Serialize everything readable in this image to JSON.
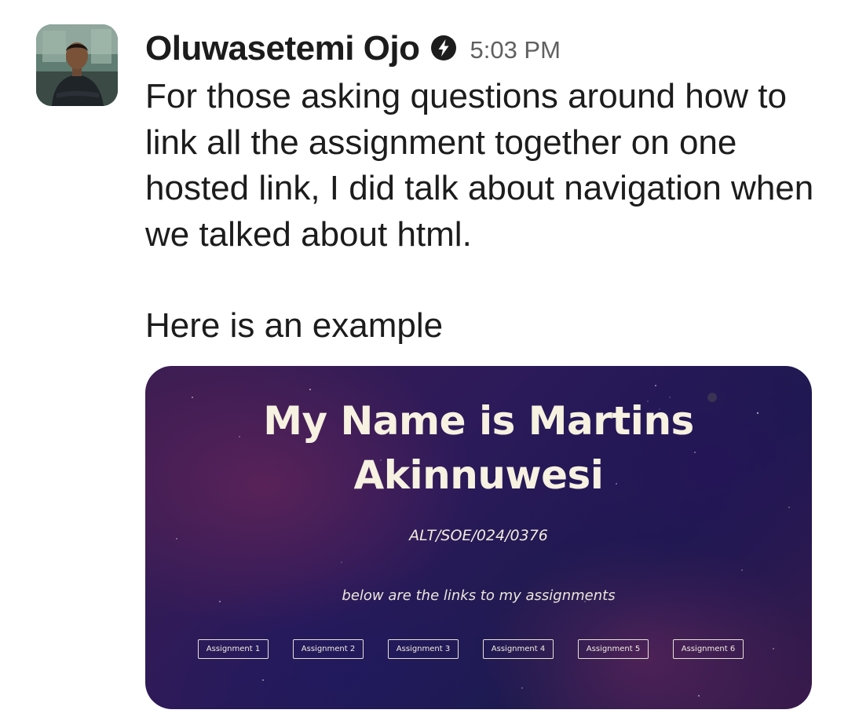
{
  "message": {
    "sender_name": "Oluwasetemi Ojo",
    "status_icon": "lightning-bolt-icon",
    "timestamp": "5:03 PM",
    "paragraph_1": "For those asking questions around how to link all the assignment together on one hosted link, I did talk about navigation when we talked about html.",
    "paragraph_2": "Here is an example"
  },
  "attachment": {
    "title_line_1": "My Name is Martins",
    "title_line_2": "Akinnuwesi",
    "student_id": "ALT/SOE/024/0376",
    "subtitle": "below are the links to my assignments",
    "buttons": [
      "Assignment 1",
      "Assignment 2",
      "Assignment 3",
      "Assignment 4",
      "Assignment 5",
      "Assignment 6"
    ]
  },
  "colors": {
    "sender_text": "#1d1c1d",
    "timestamp_text": "#616061",
    "attachment_bg_dark": "#1c1a4e",
    "attachment_bg_purple": "#3c1d52",
    "attachment_title": "#f6f1e0"
  }
}
